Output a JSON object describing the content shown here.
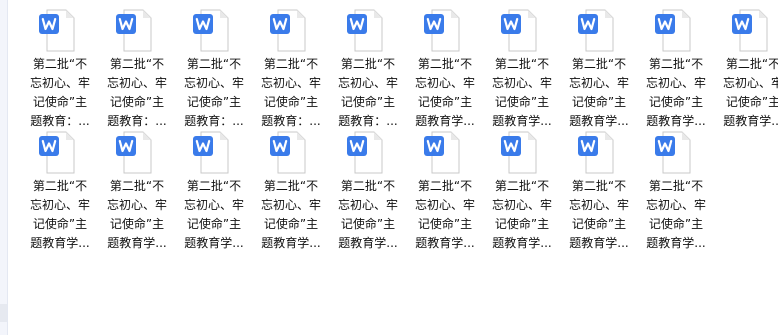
{
  "files": [
    {
      "lines": [
        "第二批“不",
        "忘初心、牢",
        "记使命”主",
        "题教育：..."
      ]
    },
    {
      "lines": [
        "第二批“不",
        "忘初心、牢",
        "记使命”主",
        "题教育：..."
      ]
    },
    {
      "lines": [
        "第二批“不",
        "忘初心、牢",
        "记使命”主",
        "题教育：..."
      ]
    },
    {
      "lines": [
        "第二批“不",
        "忘初心、牢",
        "记使命”主",
        "题教育：..."
      ]
    },
    {
      "lines": [
        "第二批“不",
        "忘初心、牢",
        "记使命”主",
        "题教育：..."
      ]
    },
    {
      "lines": [
        "第二批“不",
        "忘初心、牢",
        "记使命”主",
        "题教育学..."
      ]
    },
    {
      "lines": [
        "第二批“不",
        "忘初心、牢",
        "记使命”主",
        "题教育学..."
      ]
    },
    {
      "lines": [
        "第二批“不",
        "忘初心、牢",
        "记使命”主",
        "题教育学..."
      ]
    },
    {
      "lines": [
        "第二批“不",
        "忘初心、牢",
        "记使命”主",
        "题教育学..."
      ]
    },
    {
      "lines": [
        "第二批“不",
        "忘初心、牢",
        "记使命”主",
        "题教育学..."
      ]
    },
    {
      "lines": [
        "第二批“不",
        "忘初心、牢",
        "记使命”主",
        "题教育学..."
      ]
    },
    {
      "lines": [
        "第二批“不",
        "忘初心、牢",
        "记使命”主",
        "题教育学..."
      ]
    },
    {
      "lines": [
        "第二批“不",
        "忘初心、牢",
        "记使命”主",
        "题教育学..."
      ]
    },
    {
      "lines": [
        "第二批“不",
        "忘初心、牢",
        "记使命”主",
        "题教育学..."
      ]
    },
    {
      "lines": [
        "第二批“不",
        "忘初心、牢",
        "记使命”主",
        "题教育学..."
      ]
    },
    {
      "lines": [
        "第二批“不",
        "忘初心、牢",
        "记使命”主",
        "题教育学..."
      ]
    },
    {
      "lines": [
        "第二批“不",
        "忘初心、牢",
        "记使命”主",
        "题教育学..."
      ]
    },
    {
      "lines": [
        "第二批“不",
        "忘初心、牢",
        "记使命”主",
        "题教育学..."
      ]
    },
    {
      "lines": [
        "第二批“不",
        "忘初心、牢",
        "记使命”主",
        "题教育学..."
      ]
    }
  ],
  "icon": {
    "name": "word-document-icon",
    "badge_color": "#3a7bea",
    "page_color": "#ffffff",
    "fold_color": "#e9e9e9",
    "border_color": "#c9c9c9"
  }
}
